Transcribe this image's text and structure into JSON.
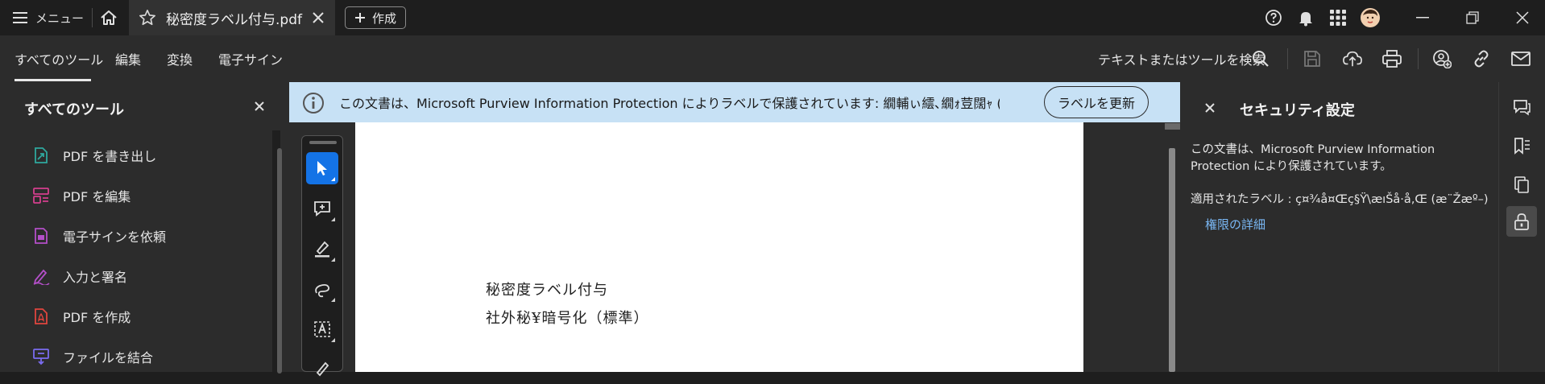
{
  "titlebar": {
    "menu_label": "メニュー",
    "tab_title": "秘密度ラベル付与.pdf (...",
    "create_label": "作成",
    "icons": [
      "hamburger-icon",
      "home-icon",
      "star-icon",
      "close-icon",
      "plus-icon",
      "help-icon",
      "bell-icon",
      "apps-grid-icon",
      "avatar",
      "minimize-icon",
      "restore-icon",
      "close-window-icon"
    ]
  },
  "toolbar": {
    "tabs": [
      "すべてのツール",
      "編集",
      "変換",
      "電子サイン"
    ],
    "search_text": "テキストまたはツールを検索",
    "icons": [
      "search-icon",
      "save-icon",
      "upload-icon",
      "print-icon",
      "share-user-icon",
      "link-icon",
      "mail-icon"
    ]
  },
  "left_panel": {
    "title": "すべてのツール",
    "items": [
      {
        "label": "PDF を書き出し",
        "icon": "export-pdf-icon",
        "color": "#2fa89e"
      },
      {
        "label": "PDF を編集",
        "icon": "edit-pdf-icon",
        "color": "#d43f8d"
      },
      {
        "label": "電子サインを依頼",
        "icon": "request-signature-icon",
        "color": "#b34fc8"
      },
      {
        "label": "入力と署名",
        "icon": "fill-sign-icon",
        "color": "#b34fc8"
      },
      {
        "label": "PDF を作成",
        "icon": "create-pdf-icon",
        "color": "#e0463e"
      },
      {
        "label": "ファイルを結合",
        "icon": "combine-files-icon",
        "color": "#7b6cf0"
      }
    ]
  },
  "banner": {
    "text": "この文書は、Microsoft Purview Information Protection によりラベルで保護されています: 繝輔ぃ繧､繝ｫ荳闊ｬ (讓呎ｺ",
    "button": "ラベルを更新",
    "bg_color": "#c7e1f5"
  },
  "document": {
    "lines": [
      "秘密度ラベル付与",
      "社外秘¥暗号化（標準）"
    ],
    "quick_tools": [
      "select-cursor-icon",
      "add-comment-icon",
      "highlight-icon",
      "draw-icon",
      "text-select-icon",
      "pen-icon"
    ]
  },
  "right_panel": {
    "title": "セキュリティ設定",
    "description": "この文書は、Microsoft Purview Information Protection により保護されています。",
    "label_line": "適用されたラベル : ç¤¾å¤Œç§Ÿ\\æıŠå·å‚Œ (æ¨Žæº–)",
    "link": "権限の詳細"
  },
  "rail": {
    "icons": [
      "comment-icon",
      "bookmark-icon",
      "pages-icon",
      "security-lock-icon"
    ],
    "active": "security-lock-icon"
  },
  "colors": {
    "accent_blue": "#1473e6",
    "link_blue": "#7ab8f5"
  }
}
